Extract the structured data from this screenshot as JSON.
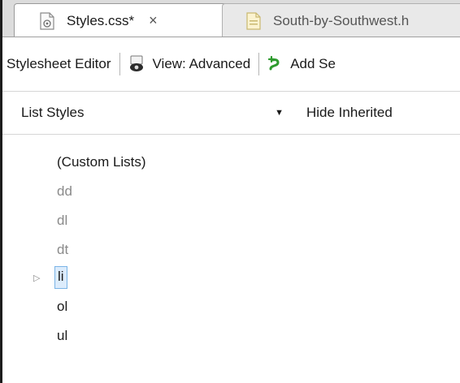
{
  "tabs": [
    {
      "label": "Styles.css*",
      "close": "×",
      "active": true,
      "icon": "css-file-icon"
    },
    {
      "label": "South-by-Southwest.h",
      "active": false,
      "icon": "html-file-icon"
    }
  ],
  "toolbar": {
    "editor_label": "Stylesheet Editor",
    "view_label": "View: Advanced",
    "view_icon": "eye-icon",
    "add_label": "Add Se",
    "add_icon": "add-style-icon"
  },
  "filter": {
    "selected": "List Styles",
    "dropdown_arrow": "▼",
    "hide_inherited": "Hide Inherited"
  },
  "tree": {
    "items": [
      {
        "label": "(Custom Lists)",
        "state": "normal"
      },
      {
        "label": "dd",
        "state": "dim"
      },
      {
        "label": "dl",
        "state": "dim"
      },
      {
        "label": "dt",
        "state": "dim"
      },
      {
        "label": "li",
        "state": "selected",
        "expander": "▷"
      },
      {
        "label": "ol",
        "state": "normal"
      },
      {
        "label": "ul",
        "state": "normal"
      }
    ]
  },
  "colors": {
    "tabstrip_bg": "#dcdcdc",
    "selection_border": "#7ab4e6",
    "selection_bg": "#dcecfc",
    "dim_text": "#8a8a8a",
    "add_icon_green": "#2e9b2e"
  }
}
